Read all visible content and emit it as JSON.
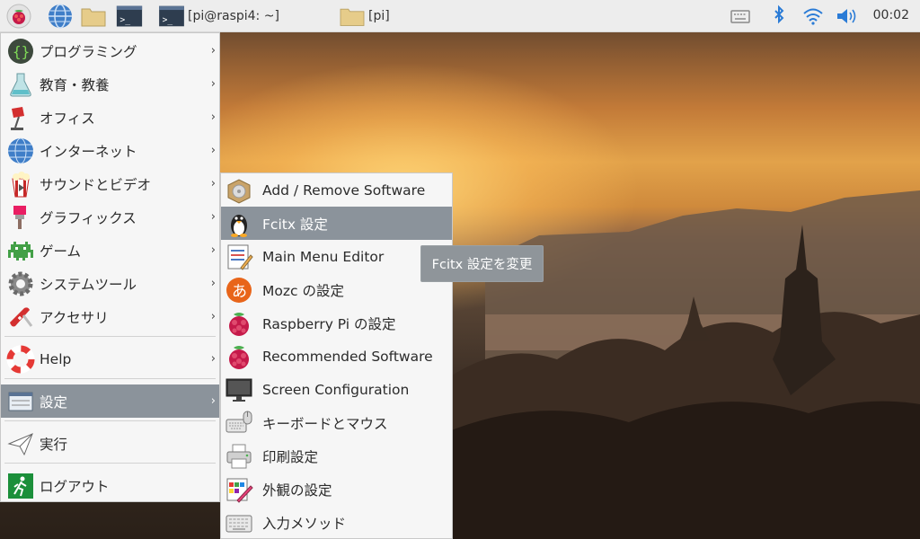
{
  "panel": {
    "tasks": [
      {
        "label": "[pi@raspi4: ~]",
        "icon": "terminal-icon"
      },
      {
        "label": "[pi]",
        "icon": "folder-icon"
      }
    ],
    "clock": "00:02"
  },
  "main_menu": {
    "items": [
      {
        "label": "プログラミング",
        "icon": "programming-icon"
      },
      {
        "label": "教育・教養",
        "icon": "education-flask-icon"
      },
      {
        "label": "オフィス",
        "icon": "office-lamp-icon"
      },
      {
        "label": "インターネット",
        "icon": "globe-icon"
      },
      {
        "label": "サウンドとビデオ",
        "icon": "popcorn-icon"
      },
      {
        "label": "グラフィックス",
        "icon": "paintbrush-icon"
      },
      {
        "label": "ゲーム",
        "icon": "space-invader-icon"
      },
      {
        "label": "システムツール",
        "icon": "gear-icon"
      },
      {
        "label": "アクセサリ",
        "icon": "swiss-knife-icon"
      },
      {
        "label": "Help",
        "icon": "lifebuoy-icon"
      },
      {
        "label": "設定",
        "icon": "settings-window-icon"
      },
      {
        "label": "実行",
        "icon": "paper-plane-icon"
      },
      {
        "label": "ログアウト",
        "icon": "exit-running-man-icon"
      }
    ]
  },
  "settings_menu": {
    "items": [
      {
        "label": "Add / Remove Software",
        "icon": "package-box-icon"
      },
      {
        "label": "Fcitx 設定",
        "icon": "penguin-icon"
      },
      {
        "label": "Main Menu Editor",
        "icon": "menu-editor-icon"
      },
      {
        "label": "Mozc の設定",
        "icon": "mozc-hiragana-icon"
      },
      {
        "label": "Raspberry Pi の設定",
        "icon": "raspberry-icon"
      },
      {
        "label": "Recommended Software",
        "icon": "raspberry-icon"
      },
      {
        "label": "Screen Configuration",
        "icon": "monitor-icon"
      },
      {
        "label": "キーボードとマウス",
        "icon": "keyboard-mouse-icon"
      },
      {
        "label": "印刷設定",
        "icon": "printer-icon"
      },
      {
        "label": "外観の設定",
        "icon": "appearance-palette-icon"
      },
      {
        "label": "入力メソッド",
        "icon": "input-keyboard-icon"
      }
    ]
  },
  "tooltip": "Fcitx 設定を変更"
}
